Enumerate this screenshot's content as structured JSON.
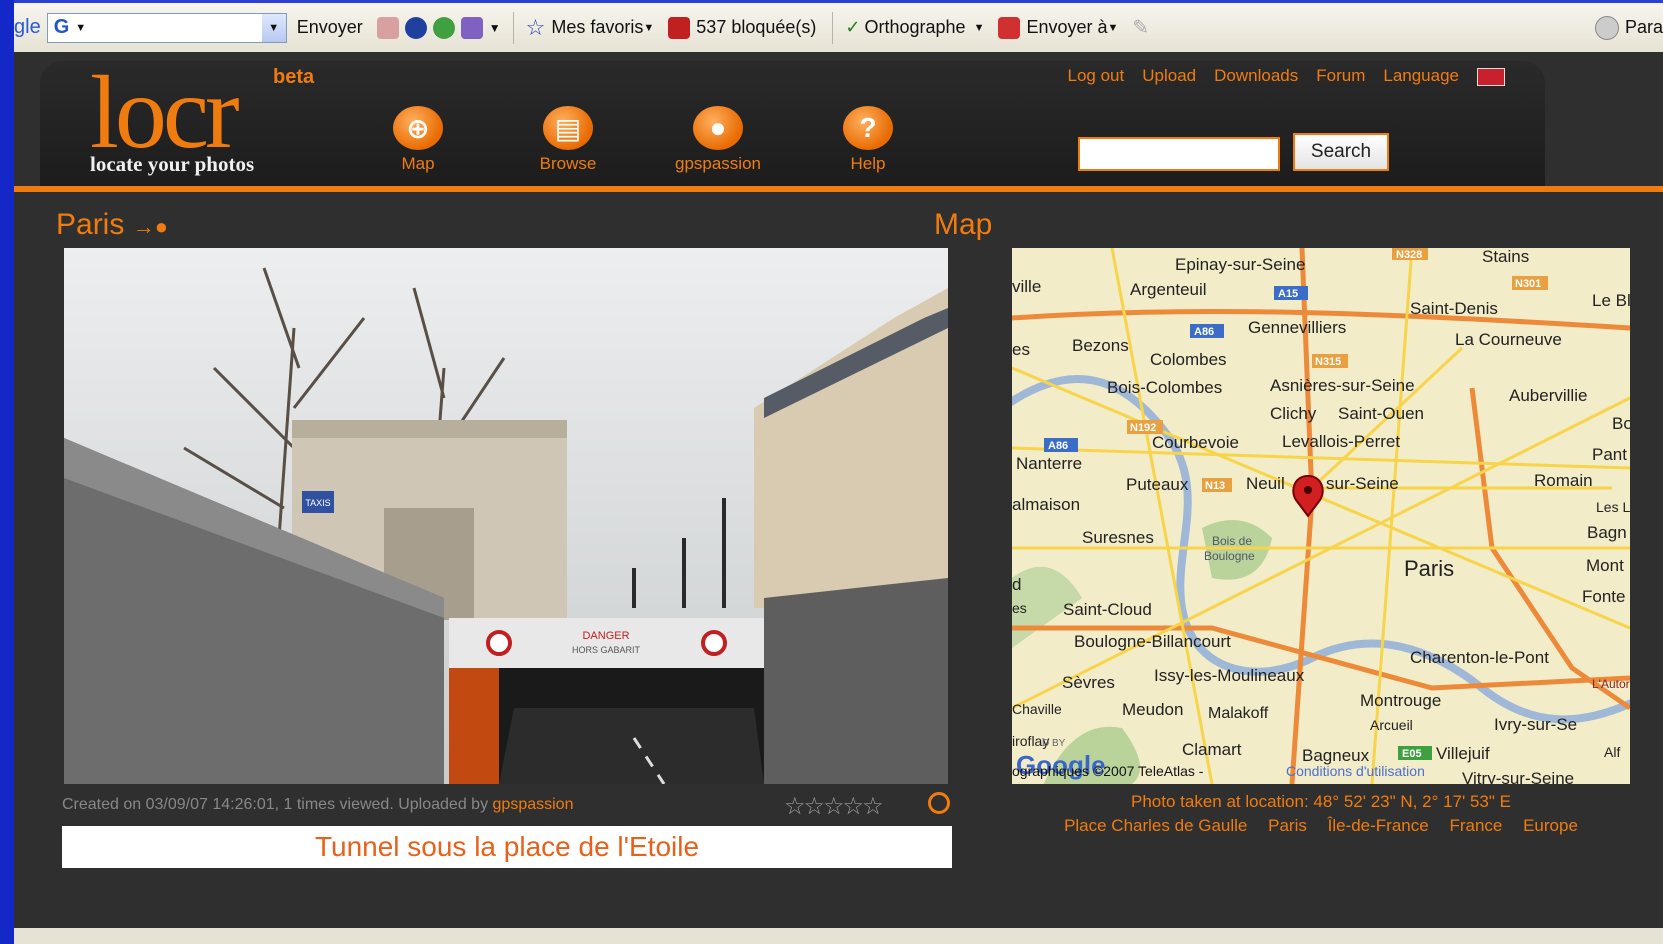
{
  "toolbar": {
    "google_prefix": "gle",
    "google_letter": "G",
    "send": "Envoyer",
    "favorites": "Mes favoris",
    "blocked": "537 bloquée(s)",
    "spelling": "Orthographe",
    "send_to": "Envoyer à",
    "params": "Para"
  },
  "header": {
    "logo": "locr",
    "beta": "beta",
    "tagline": "locate your photos",
    "nav": [
      "Map",
      "Browse",
      "gpspassion",
      "Help"
    ],
    "top_links": [
      "Log out",
      "Upload",
      "Downloads",
      "Forum",
      "Language"
    ],
    "search_button": "Search"
  },
  "photo": {
    "title": "Paris",
    "meta": "Created on 03/09/07 14:26:01, 1 times viewed. Uploaded by",
    "uploader": "gpspassion",
    "rating_stars": "☆☆☆☆☆",
    "caption": "Tunnel sous la place de l'Etoile",
    "scene_texts": {
      "taxis": "TAXIS",
      "danger": "DANGER",
      "hors_gabarit": "HORS GABARIT"
    }
  },
  "map": {
    "title": "Map",
    "location": "Photo taken at location: 48° 52' 23\" N, 2° 17' 53\" E",
    "places": [
      "Place Charles de Gaulle",
      "Paris",
      "Île-de-France",
      "France",
      "Europe"
    ],
    "labels": {
      "epinay": "Epinay-sur-Seine",
      "argenteuil": "Argenteuil",
      "stains": "Stains",
      "saint_denis": "Saint-Denis",
      "le_b": "Le Bl",
      "ville": "ville",
      "gennevilliers": "Gennevilliers",
      "la_courneuve": "La Courneuve",
      "es1": "es",
      "bezons": "Bezons",
      "colombes": "Colombes",
      "bois_colombes": "Bois-Colombes",
      "asnieres": "Asnières-sur-Seine",
      "aubervillie": "Aubervillie",
      "clichy": "Clichy",
      "saint_ouen": "Saint-Ouen",
      "bo": "Bo",
      "courbevoie": "Courbevoie",
      "levallois": "Levallois-Perret",
      "pant": "Pant",
      "nanterre": "Nanterre",
      "puteaux": "Puteaux",
      "neuilly_a": "Neuil",
      "neuilly_b": "sur-Seine",
      "romain": "Romain",
      "almaison": "almaison",
      "les_l": "Les L",
      "suresnes": "Suresnes",
      "bois_de": "Bois de",
      "boulogne_bois": "Boulogne",
      "bagr": "Bagn",
      "paris": "Paris",
      "mont": "Mont",
      "d": "d",
      "es2": "es",
      "saint_cloud": "Saint-Cloud",
      "fonte": "Fonte",
      "boulogne_b": "Boulogne-Billancourt",
      "charenton": "Charenton-le-Pont",
      "sevres": "Sèvres",
      "issy": "Issy-les-Moulineaux",
      "autor": "L'Autor",
      "chaville": "Chaville",
      "meudon": "Meudon",
      "malakoff": "Malakoff",
      "montrouge": "Montrouge",
      "arcueil": "Arcueil",
      "ivry": "Ivry-sur-Se",
      "alf": "Alf",
      "roflay": "iroflay",
      "by": "D BY",
      "clamart": "Clamart",
      "bagneux": "Bagneux",
      "villejuif": "Villejuif",
      "vitry": "Vitry-sur-Seine",
      "google": "Google",
      "copyright": "ographiques ©2007 TeleAtlas -",
      "conditions": "Conditions d'utilisation"
    },
    "road_badges": {
      "n328": "N328",
      "n301": "N301",
      "a15": "A15",
      "a86a": "A86",
      "n315": "N315",
      "n192": "N192",
      "a86b": "A86",
      "n13": "N13",
      "e05": "E05"
    }
  },
  "colors": {
    "accent": "#f07c10",
    "background": "#2f2f2f",
    "desktop": "#1428c8"
  }
}
